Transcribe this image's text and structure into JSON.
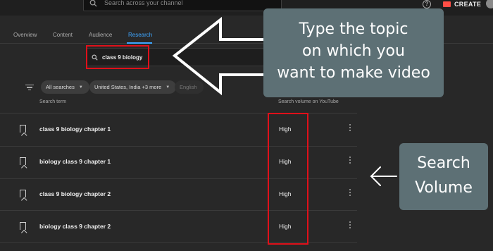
{
  "topbar": {
    "search_placeholder": "Search across your channel",
    "help_glyph": "?",
    "create_label": "CREATE"
  },
  "tabs": [
    {
      "label": "Overview",
      "active": false
    },
    {
      "label": "Content",
      "active": false
    },
    {
      "label": "Audience",
      "active": false
    },
    {
      "label": "Research",
      "active": true
    }
  ],
  "research": {
    "query": "class 9 biology"
  },
  "filters": {
    "chips": [
      "All searches",
      "United States, India +3 more"
    ],
    "language": "English"
  },
  "table": {
    "col_term": "Search term",
    "col_volume": "Search volume on YouTube",
    "rows": [
      {
        "term": "class 9 biology chapter 1",
        "volume": "High"
      },
      {
        "term": "biology class 9 chapter 1",
        "volume": "High"
      },
      {
        "term": "class 9 biology chapter 2",
        "volume": "High"
      },
      {
        "term": "biology class 9 chapter 2",
        "volume": "High"
      }
    ]
  },
  "annotations": {
    "top_lines": [
      "Type the topic",
      "on which you",
      "want to make video"
    ],
    "right_lines": [
      "Search",
      "Volume"
    ],
    "callout_color": "#5d7075",
    "highlight_color": "#e0101a"
  },
  "colors": {
    "accent": "#3ea6ff",
    "background": "#282828"
  }
}
